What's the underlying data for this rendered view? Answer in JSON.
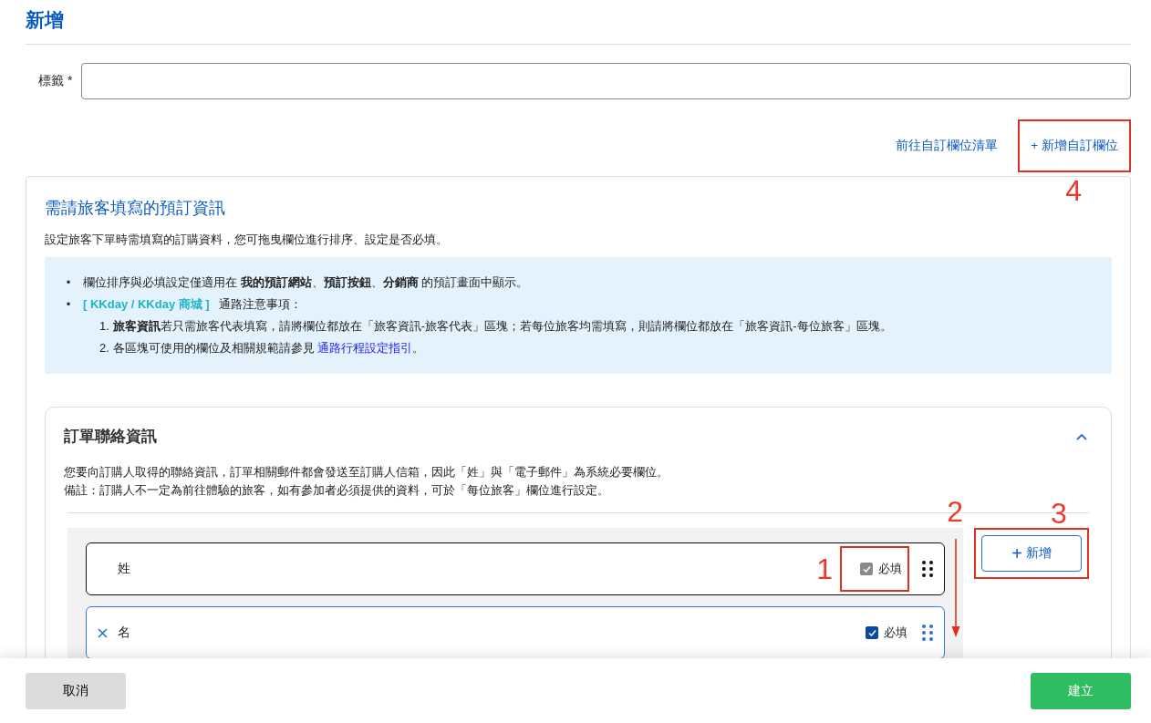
{
  "page_title": "新增",
  "label_field": {
    "label": "標籤 *"
  },
  "links": [
    {
      "text": "前往自訂欄位清單"
    },
    {
      "text": "+ 新增自訂欄位",
      "annotation": "4"
    }
  ],
  "booking_card": {
    "title": "需請旅客填寫的預訂資訊",
    "description": "設定旅客下單時需填寫的訂購資料，您可拖曳欄位進行排序、設定是否必填。",
    "notice": {
      "bullets": [
        {
          "marker": "•",
          "text": "欄位排序與必填設定僅適用在 **我的預訂網站**、**預訂按鈕**、**分銷商** 的預訂畫面中顯示。"
        },
        {
          "marker": "•",
          "tag": "[ KKday / KKday 商城 ]",
          "text": "通路注意事項：",
          "items": [
            {
              "marker": "1.",
              "text": "**旅客資訊**若只需旅客代表填寫，請將欄位都放在「旅客資訊-旅客代表」區塊；若每位旅客均需填寫，則請將欄位都放在「旅客資訊-每位旅客」區塊。"
            },
            {
              "marker": "2.",
              "text": "各區塊可使用的欄位及相關規範請參見 ",
              "link": "通路行程設定指引",
              "after": "。"
            }
          ]
        }
      ]
    }
  },
  "section": {
    "title": "訂單聯絡資訊",
    "expanded": true,
    "description": [
      "您要向訂購人取得的聯絡資訊，訂單相關郵件都會發送至訂購人信箱，因此「姓」與「電子郵件」為系統必要欄位。",
      "備註：訂購人不一定為前往體驗的旅客，如有參加者必須提供的資料，可於「每位旅客」欄位進行設定。"
    ],
    "list_annotation": "2",
    "fields": [
      {
        "label": "姓",
        "removable": false,
        "selected": false,
        "required": {
          "label": "必填",
          "checked": true,
          "disabled": true,
          "annotation": "1"
        }
      },
      {
        "label": "名",
        "removable": true,
        "selected": true,
        "required": {
          "label": "必填",
          "checked": true,
          "disabled": false
        }
      }
    ],
    "add_button": {
      "icon": "+",
      "label": "新增",
      "annotation": "3"
    }
  },
  "footer": {
    "cancel": "取消",
    "create": "建立"
  }
}
